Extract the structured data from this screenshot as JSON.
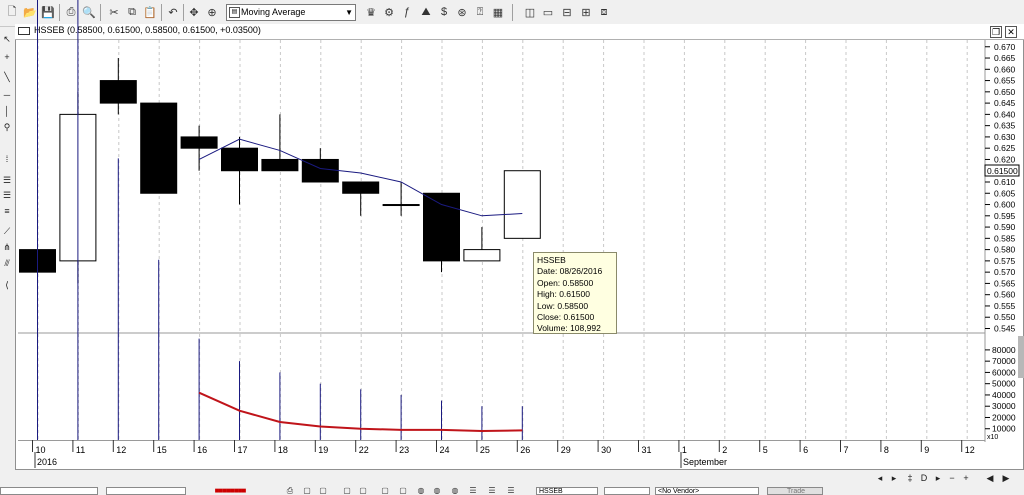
{
  "toolbar": {
    "study_label": "Moving Average"
  },
  "chart": {
    "title": "HSSEB (0.58500, 0.61500, 0.58500, 0.61500, +0.03500)",
    "last_price": "0.61500",
    "volume_multiplier": "x10"
  },
  "chart_data": {
    "type": "candlestick",
    "symbol": "HSSEB",
    "x_dates": [
      "10",
      "11",
      "12",
      "15",
      "16",
      "17",
      "18",
      "19",
      "22",
      "23",
      "24",
      "25",
      "26"
    ],
    "open": [
      0.58,
      0.575,
      0.655,
      0.645,
      0.63,
      0.625,
      0.62,
      0.62,
      0.61,
      0.6,
      0.605,
      0.575,
      0.585
    ],
    "high": [
      0.585,
      0.65,
      0.665,
      0.645,
      0.635,
      0.63,
      0.64,
      0.625,
      0.61,
      0.61,
      0.605,
      0.59,
      0.615
    ],
    "low": [
      0.55,
      0.565,
      0.64,
      0.605,
      0.615,
      0.6,
      0.615,
      0.61,
      0.595,
      0.595,
      0.57,
      0.575,
      0.585
    ],
    "close": [
      0.57,
      0.64,
      0.645,
      0.605,
      0.625,
      0.615,
      0.615,
      0.61,
      0.605,
      0.6,
      0.575,
      0.58,
      0.615
    ],
    "moving_average": [
      null,
      null,
      null,
      null,
      0.62,
      0.629,
      0.624,
      0.616,
      0.614,
      0.61,
      0.6,
      0.595,
      0.596
    ],
    "volume": [
      850000,
      600000,
      250000,
      160000,
      90000,
      70000,
      60000,
      50000,
      45000,
      40000,
      35000,
      30000,
      30000
    ],
    "volume_average": [
      null,
      null,
      null,
      null,
      42000,
      26000,
      16000,
      12000,
      10000,
      9000,
      9000,
      8000,
      8500
    ],
    "price_axis": {
      "ticks": [
        "0.670",
        "0.665",
        "0.660",
        "0.655",
        "0.650",
        "0.645",
        "0.640",
        "0.635",
        "0.630",
        "0.625",
        "0.620",
        "0.615",
        "0.610",
        "0.605",
        "0.600",
        "0.595",
        "0.590",
        "0.585",
        "0.580",
        "0.575",
        "0.570",
        "0.565",
        "0.560",
        "0.555",
        "0.550",
        "0.545"
      ],
      "ylim": [
        0.543,
        0.673
      ]
    },
    "volume_axis": {
      "ticks": [
        "80000",
        "70000",
        "60000",
        "50000",
        "40000",
        "30000",
        "20000",
        "10000"
      ],
      "ylim": [
        0,
        95000
      ]
    },
    "date_axis": {
      "labels": [
        "10",
        "11",
        "12",
        "15",
        "16",
        "17",
        "18",
        "19",
        "22",
        "23",
        "24",
        "25",
        "26",
        "29",
        "30",
        "31",
        "1",
        "2",
        "5",
        "6",
        "7",
        "8",
        "9",
        "12"
      ],
      "year_label": "2016",
      "month_label": "September"
    }
  },
  "tooltip": {
    "lines": [
      "HSSEB",
      "Date: 08/26/2016",
      "Open: 0.58500",
      "High: 0.61500",
      "Low: 0.58500",
      "Close: 0.61500",
      "Volume: 108,992"
    ]
  },
  "status": {
    "symbol": "HSSEB",
    "vendor": "<No Vendor>",
    "trade_label": "Trade"
  },
  "colors": {
    "up_candle": "#ffffff",
    "down_candle": "#000000",
    "ma_line": "#1a1a80",
    "volume_bar": "#1a1a80",
    "volume_ma": "#c0141a",
    "tooltip_bg": "#ffffe1"
  }
}
